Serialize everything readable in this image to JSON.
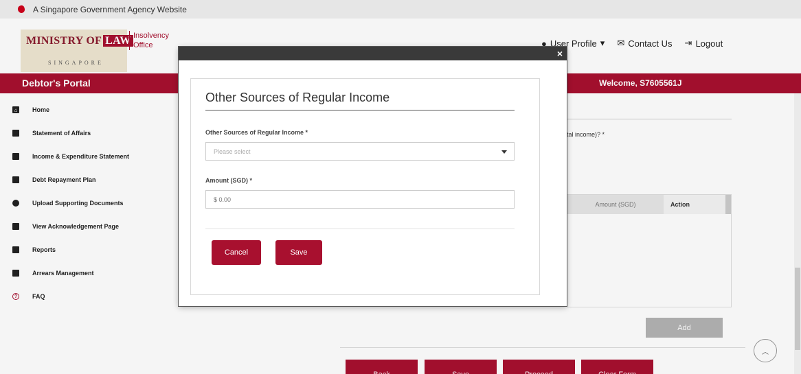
{
  "gov_banner": {
    "text": "A Singapore Government Agency Website"
  },
  "header": {
    "logo_main": "MINISTRY OF",
    "logo_law": "LAW",
    "logo_sub": "SINGAPORE",
    "logo_office_line1": "Insolvency",
    "logo_office_line2": "Office",
    "nav": {
      "user_profile": "User Profile",
      "contact_us": "Contact Us",
      "logout": "Logout"
    }
  },
  "portal_bar": {
    "title": "Debtor's Portal",
    "welcome": "Welcome, S7605561J"
  },
  "sidebar": {
    "items": [
      {
        "label": "Home",
        "icon": "home-icon"
      },
      {
        "label": "Statement of Affairs",
        "icon": "document-icon"
      },
      {
        "label": "Income & Expenditure Statement",
        "icon": "ledger-icon"
      },
      {
        "label": "Debt Repayment Plan",
        "icon": "plan-icon"
      },
      {
        "label": "Upload Supporting Documents",
        "icon": "cloud-upload-icon"
      },
      {
        "label": "View Acknowledgement Page",
        "icon": "file-icon"
      },
      {
        "label": "Reports",
        "icon": "book-icon"
      },
      {
        "label": "Arrears Management",
        "icon": "file-icon"
      },
      {
        "label": "FAQ",
        "icon": "question-icon"
      }
    ]
  },
  "background": {
    "question_fragment": "tal income)? *",
    "table_headers": {
      "amount": "Amount (SGD)",
      "action": "Action"
    },
    "add_button": "Add",
    "buttons": {
      "back": "Back",
      "save": "Save",
      "proceed": "Proceed",
      "clear": "Clear Form"
    }
  },
  "modal": {
    "close": "×",
    "title": "Other Sources of Regular Income",
    "select_label": "Other Sources of Regular Income *",
    "select_placeholder": "Please select",
    "amount_label": "Amount (SGD) *",
    "amount_placeholder": "$ 0.00",
    "cancel_button": "Cancel",
    "save_button": "Save"
  },
  "colors": {
    "brand": "#a8102f",
    "modal_header": "#3a3a3a",
    "disabled_button": "#b3b3b3"
  }
}
